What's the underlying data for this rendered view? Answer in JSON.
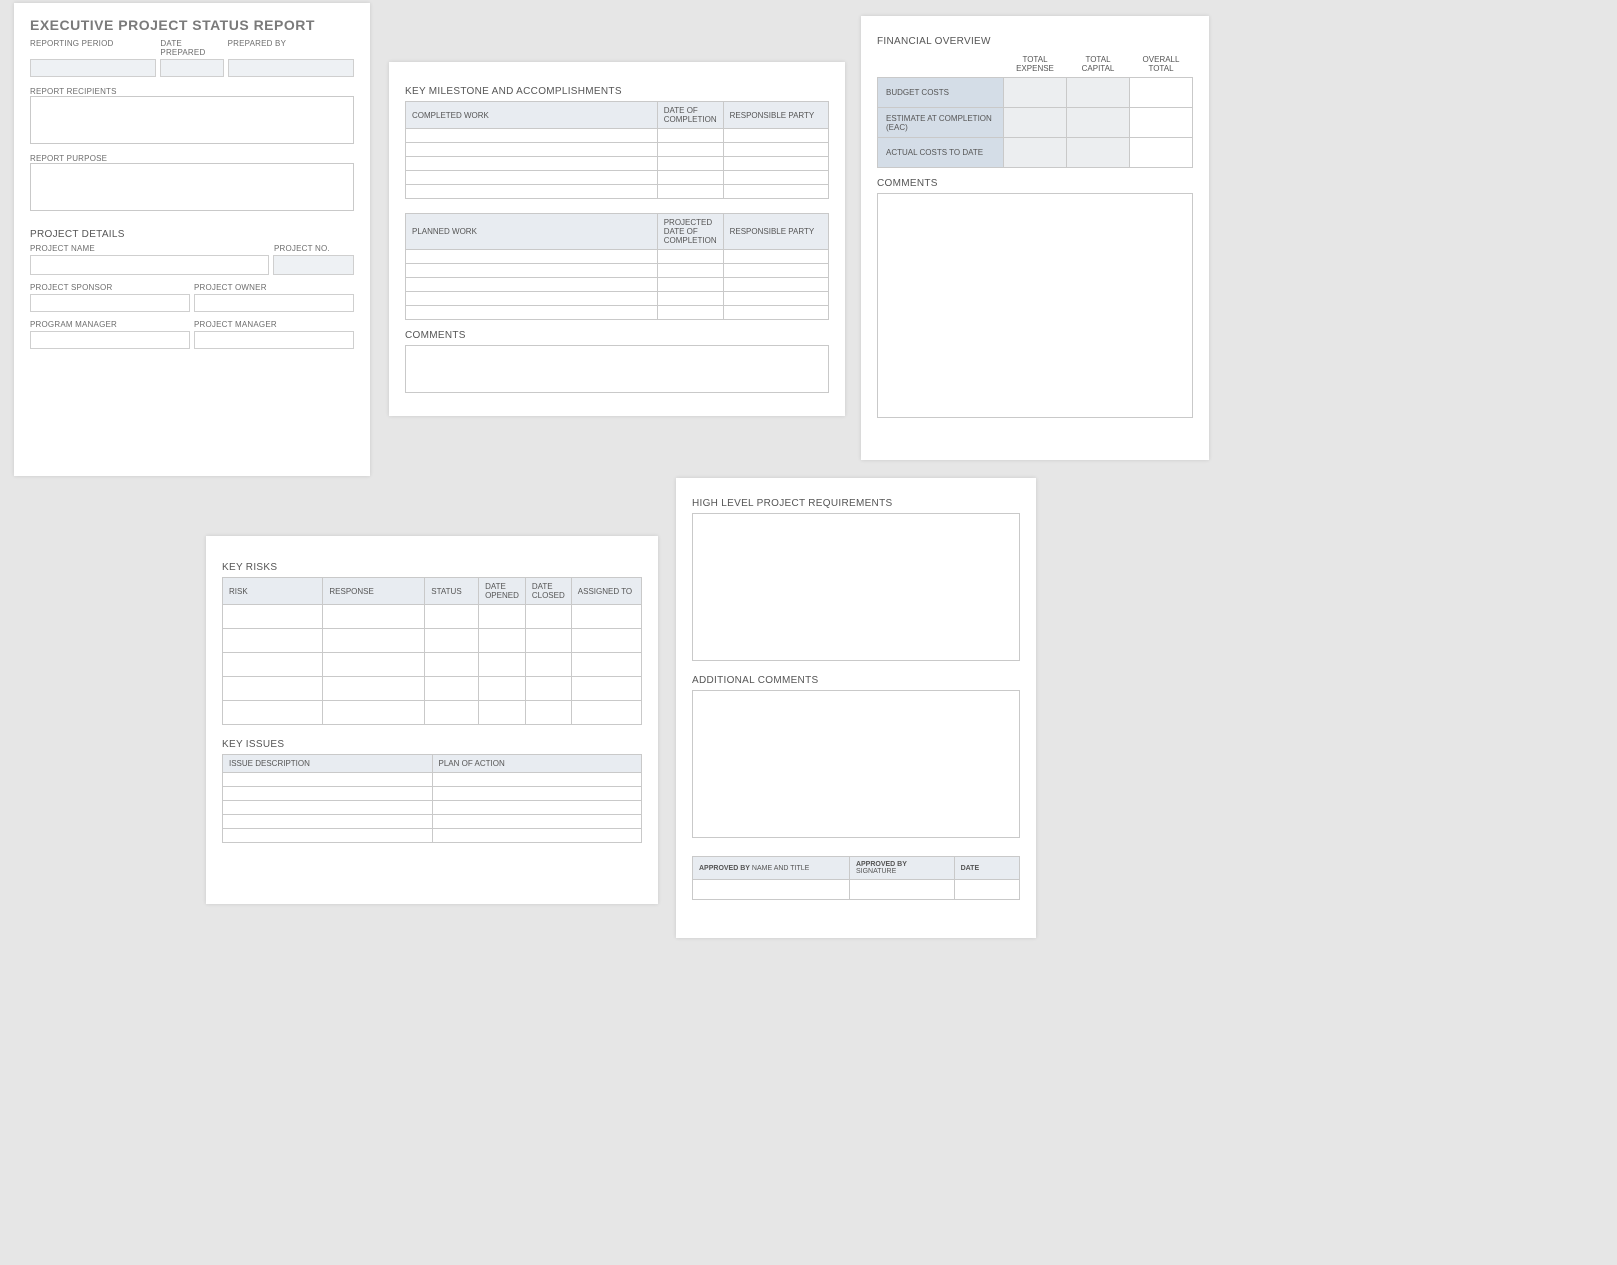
{
  "page1": {
    "title": "EXECUTIVE PROJECT STATUS REPORT",
    "reporting_period": "REPORTING PERIOD",
    "date_prepared": "DATE PREPARED",
    "prepared_by": "PREPARED BY",
    "report_recipients": "REPORT RECIPIENTS",
    "report_purpose": "REPORT PURPOSE",
    "project_details": "PROJECT DETAILS",
    "project_name": "PROJECT NAME",
    "project_no": "PROJECT NO.",
    "project_sponsor": "PROJECT SPONSOR",
    "project_owner": "PROJECT OWNER",
    "program_manager": "PROGRAM MANAGER",
    "project_manager": "PROJECT MANAGER"
  },
  "page2": {
    "milestone_title": "KEY MILESTONE AND ACCOMPLISHMENTS",
    "completed_work": "COMPLETED WORK",
    "date_completion": "DATE OF COMPLETION",
    "responsible_party": "RESPONSIBLE PARTY",
    "planned_work": "PLANNED WORK",
    "projected_date": "PROJECTED DATE OF COMPLETION",
    "comments": "COMMENTS"
  },
  "page3": {
    "fin_title": "FINANCIAL OVERVIEW",
    "total_expense": "TOTAL EXPENSE",
    "total_capital": "TOTAL CAPITAL",
    "overall_total": "OVERALL TOTAL",
    "budget_costs": "BUDGET COSTS",
    "eac": "ESTIMATE AT COMPLETION (EAC)",
    "actual": "ACTUAL COSTS TO DATE",
    "comments": "COMMENTS"
  },
  "page4": {
    "risks_title": "KEY RISKS",
    "risk": "RISK",
    "response": "RESPONSE",
    "status": "STATUS",
    "date_opened": "DATE OPENED",
    "date_closed": "DATE CLOSED",
    "assigned_to": "ASSIGNED TO",
    "issues_title": "KEY ISSUES",
    "issue_desc": "ISSUE DESCRIPTION",
    "plan": "PLAN OF ACTION"
  },
  "page5": {
    "req_title": "HIGH LEVEL PROJECT REQUIREMENTS",
    "add_comments": "ADDITIONAL COMMENTS",
    "approved_by_name": "APPROVED BY",
    "name_title": " NAME AND TITLE",
    "approved_by_sig": "APPROVED BY",
    "signature": " SIGNATURE",
    "date": "DATE"
  }
}
